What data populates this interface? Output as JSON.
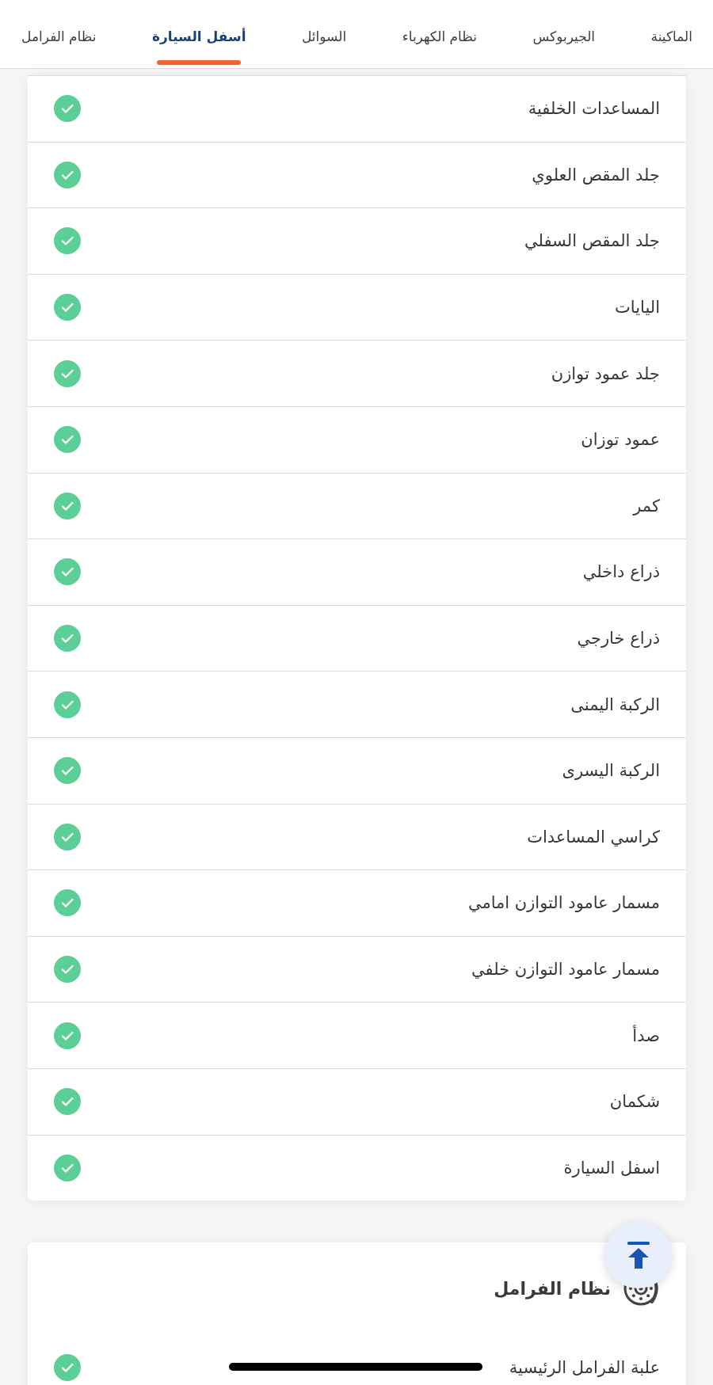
{
  "tabs": [
    {
      "label": "الماكينة",
      "selected": false
    },
    {
      "label": "الجيربوكس",
      "selected": false
    },
    {
      "label": "نظام الكهرباء",
      "selected": false
    },
    {
      "label": "السوائل",
      "selected": false
    },
    {
      "label": "أسفل السيارة",
      "selected": true
    },
    {
      "label": "نظام الفرامل",
      "selected": false
    }
  ],
  "underbody_checklist": {
    "items": [
      {
        "label": "المساعدات الخلفية",
        "checked": true
      },
      {
        "label": "جلد المقص العلوي",
        "checked": true
      },
      {
        "label": "جلد المقص السفلي",
        "checked": true
      },
      {
        "label": "اليايات",
        "checked": true
      },
      {
        "label": "جلد عمود توازن",
        "checked": true
      },
      {
        "label": "عمود توزان",
        "checked": true
      },
      {
        "label": "كمر",
        "checked": true
      },
      {
        "label": "ذراع داخلي",
        "checked": true
      },
      {
        "label": "ذراع خارجي",
        "checked": true
      },
      {
        "label": "الركبة اليمنى",
        "checked": true
      },
      {
        "label": "الركبة اليسرى",
        "checked": true
      },
      {
        "label": "كراسي المساعدات",
        "checked": true
      },
      {
        "label": "مسمار عامود التوازن امامي",
        "checked": true
      },
      {
        "label": "مسمار عامود التوازن خلفي",
        "checked": true
      },
      {
        "label": "صدأ",
        "checked": true
      },
      {
        "label": "شكمان",
        "checked": true
      },
      {
        "label": "اسفل السيارة",
        "checked": true
      }
    ]
  },
  "brakes_section": {
    "title": "نظام الفرامل",
    "items": [
      {
        "label": "علبة الفرامل الرئيسية",
        "checked": true
      }
    ]
  }
}
